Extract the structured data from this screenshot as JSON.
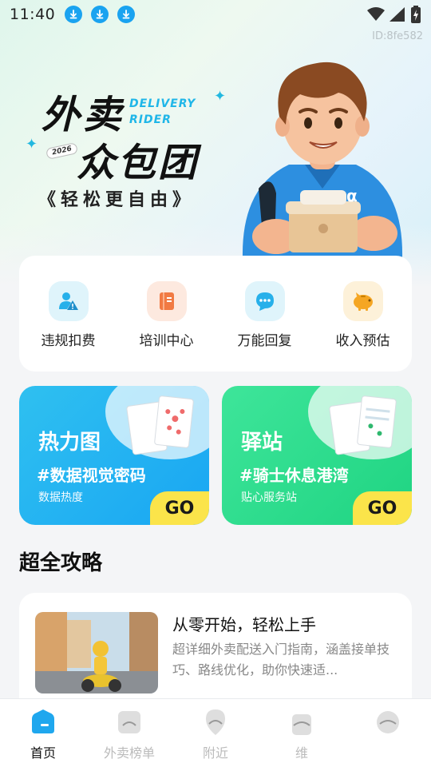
{
  "status_bar": {
    "time": "11:40",
    "download_count": 3
  },
  "device_id": "ID:8fe582",
  "hero": {
    "title_line1": "外卖",
    "title_en": "DELIVERY\nRIDER",
    "title_line2": "众包团",
    "year": "2026",
    "subtitle": "《轻松更自由》"
  },
  "quick_actions": [
    {
      "label": "违规扣费",
      "icon": "violation-icon",
      "bg": "#dff4fb",
      "color": "#27b0ea"
    },
    {
      "label": "培训中心",
      "icon": "book-icon",
      "bg": "#fde9df",
      "color": "#f17a43"
    },
    {
      "label": "万能回复",
      "icon": "chat-icon",
      "bg": "#dff4fb",
      "color": "#27b0ea"
    },
    {
      "label": "收入预估",
      "icon": "piggy-bank-icon",
      "bg": "#fdf1d9",
      "color": "#f5a623"
    }
  ],
  "features": [
    {
      "title": "热力图",
      "subtitle": "#数据视觉密码",
      "note": "数据热度",
      "go": "GO"
    },
    {
      "title": "驿站",
      "subtitle": "#骑士休息港湾",
      "note": "贴心服务站",
      "go": "GO"
    }
  ],
  "section_title": "超全攻略",
  "guide": {
    "title": "从零开始，轻松上手",
    "desc": "超详细外卖配送入门指南，涵盖接单技巧、路线优化，助你快速适..."
  },
  "nav": [
    {
      "label": "首页",
      "active": true
    },
    {
      "label": "外卖榜单",
      "active": false
    },
    {
      "label": "附近",
      "active": false
    },
    {
      "label": "维",
      "active": false
    },
    {
      "label": "",
      "active": false
    }
  ],
  "colors": {
    "accent_blue": "#1aa3f0",
    "accent_green": "#1fd482",
    "go_yellow": "#fbe44a"
  }
}
